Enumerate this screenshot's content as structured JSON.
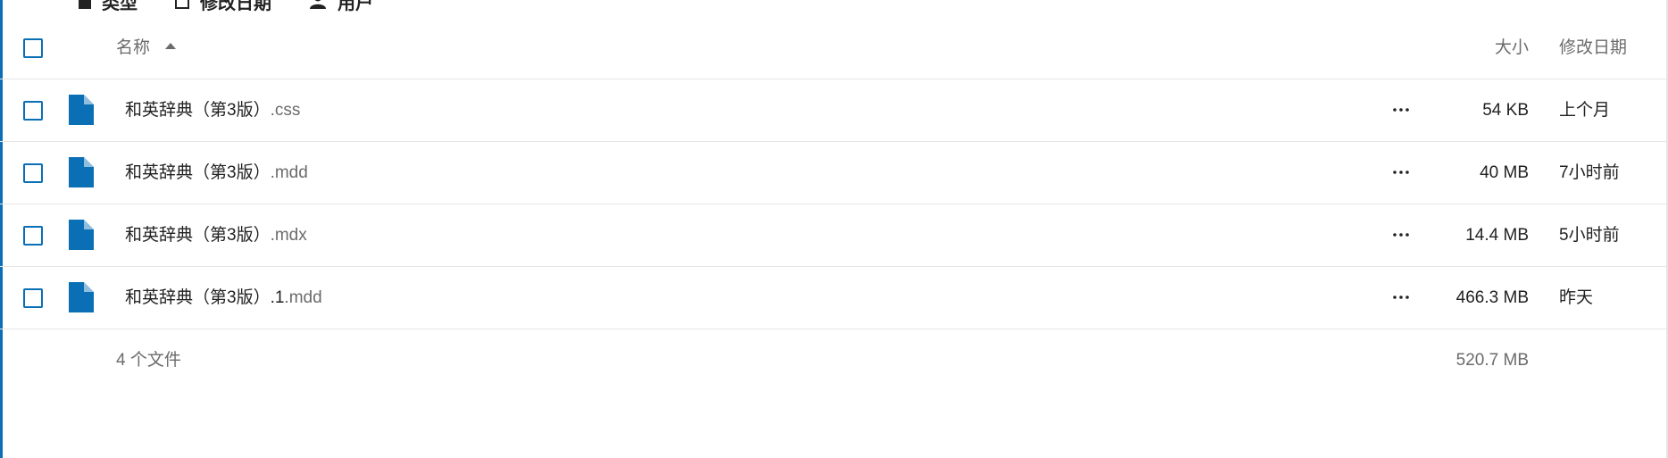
{
  "toolbar": {
    "filters": [
      {
        "label": "类型",
        "icon": "file-type-icon"
      },
      {
        "label": "修改日期",
        "icon": "calendar-icon"
      },
      {
        "label": "用户",
        "icon": "user-icon"
      }
    ]
  },
  "table": {
    "header": {
      "name_label": "名称",
      "sort_icon": "sort-ascending-icon",
      "size_label": "大小",
      "date_label": "修改日期"
    },
    "rows": [
      {
        "name": "和英辞典（第3版）",
        "ext": ".css",
        "size": "54 KB",
        "modified": "上个月"
      },
      {
        "name": "和英辞典（第3版）",
        "ext": ".mdd",
        "size": "40 MB",
        "modified": "7小时前"
      },
      {
        "name": "和英辞典（第3版）",
        "ext": ".mdx",
        "size": "14.4 MB",
        "modified": "5小时前"
      },
      {
        "name": "和英辞典（第3版）.1",
        "ext": ".mdd",
        "size": "466.3 MB",
        "modified": "昨天"
      }
    ],
    "footer": {
      "count": "4 个文件",
      "total_size": "520.7 MB"
    }
  },
  "colors": {
    "accent": "#0a6fb5",
    "text_primary": "#222222",
    "text_secondary": "#6b6b6b",
    "divider": "#e6e6e6"
  }
}
